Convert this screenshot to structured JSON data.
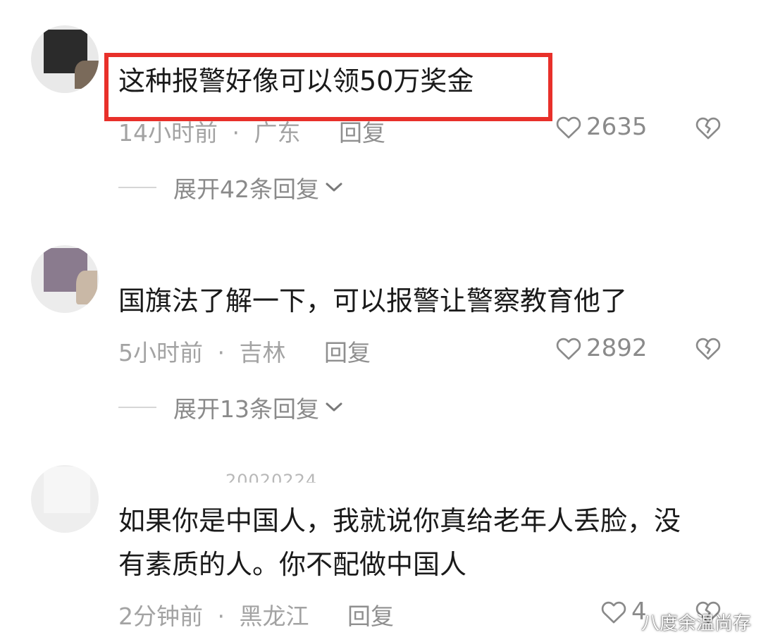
{
  "comments": [
    {
      "text": "这种报警好像可以领50万奖金",
      "time": "14小时前",
      "location": "广东",
      "reply_label": "回复",
      "likes": "2635",
      "expand_label": "展开42条回复",
      "highlighted": true
    },
    {
      "text": "国旗法了解一下，可以报警让警察教育他了",
      "time": "5小时前",
      "location": "吉林",
      "reply_label": "回复",
      "likes": "2892",
      "expand_label": "展开13条回复"
    },
    {
      "username_fragment": "20020224",
      "text_line1": "如果你是中国人，我就说你真给老年人丢脸，没",
      "text_line2": "有素质的人。你不配做中国人",
      "time": "2分钟前",
      "location": "黑龙江",
      "reply_label": "回复",
      "likes": "4"
    }
  ],
  "separator": "·",
  "watermark": "八度余温尚存",
  "icons": {
    "like": "heart-outline-icon",
    "dislike": "broken-heart-icon",
    "expand": "chevron-down-icon"
  },
  "colors": {
    "highlight_box": "#e8302a",
    "meta_text": "#a3a3a3",
    "body_text": "#1a1a1a"
  }
}
